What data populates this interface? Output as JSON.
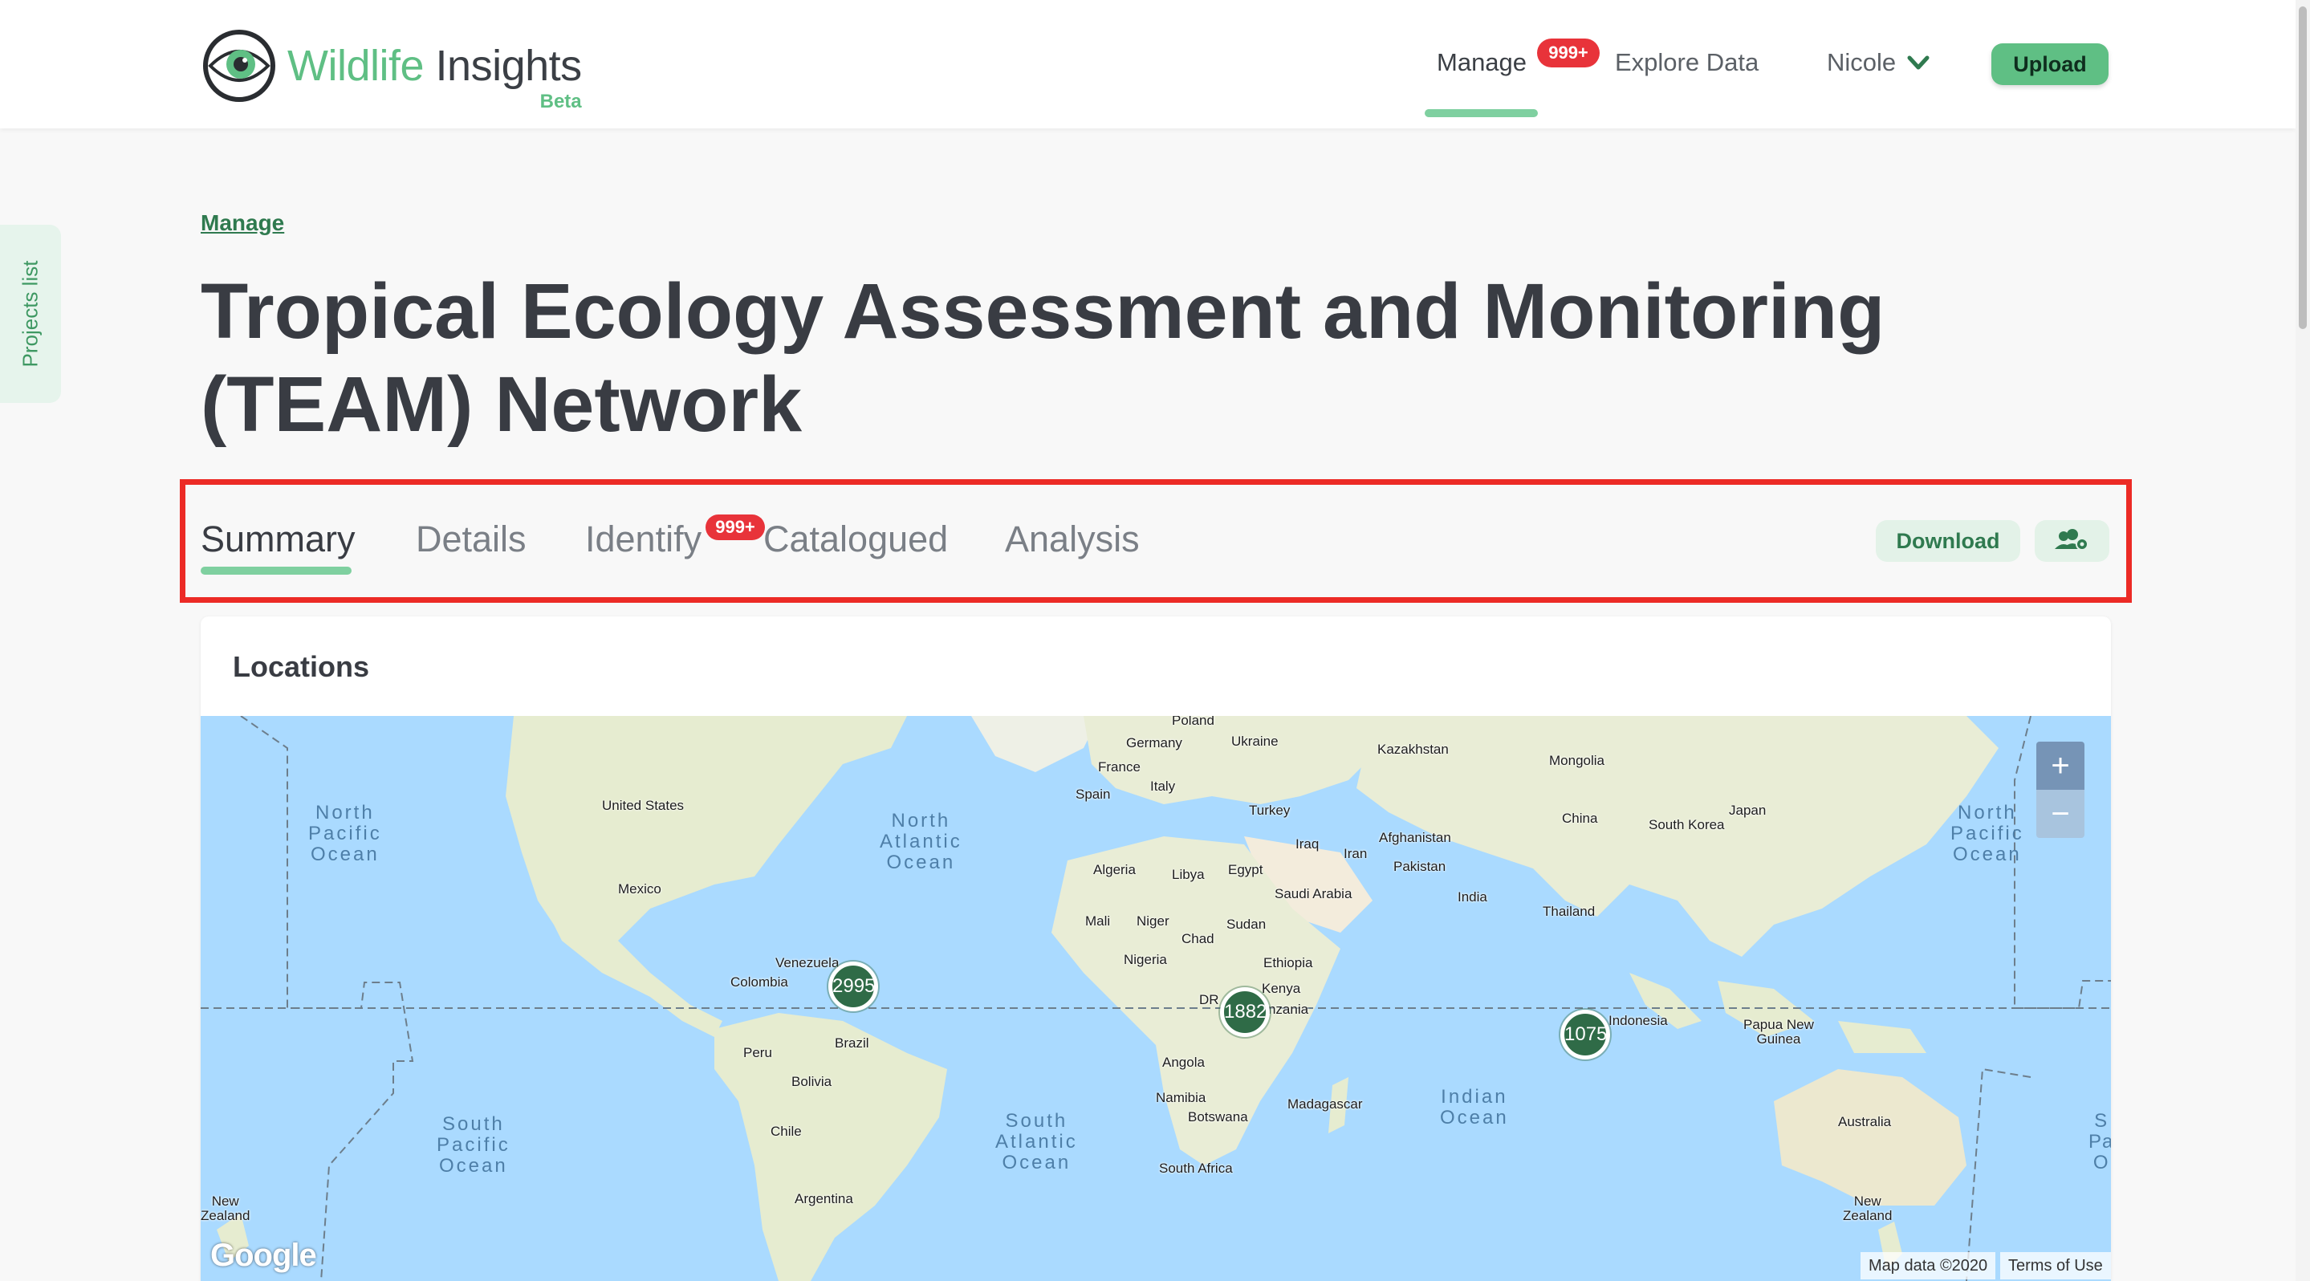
{
  "brand": {
    "name_part1": "Wildlife",
    "name_part2": " Insights",
    "tag": "Beta",
    "color": "#5fbf84"
  },
  "nav": {
    "manage": "Manage",
    "manage_badge": "999+",
    "explore": "Explore Data",
    "user": "Nicole",
    "upload": "Upload"
  },
  "side_tab": {
    "label": "Projects list"
  },
  "breadcrumb": "Manage",
  "title": "Tropical Ecology Assessment and Monitoring (TEAM) Network",
  "tabs": {
    "summary": "Summary",
    "details": "Details",
    "identify": "Identify",
    "identify_badge": "999+",
    "catalogued": "Catalogued",
    "analysis": "Analysis",
    "active": "Summary"
  },
  "actions": {
    "download": "Download",
    "settings_icon": "users-gear-icon"
  },
  "locations": {
    "title": "Locations",
    "zoom_in": "+",
    "zoom_out": "−",
    "clusters": {
      "america": "2995",
      "africa": "1882",
      "asia": "1075"
    },
    "countries": {
      "poland": "Poland",
      "germany": "Germany",
      "ukraine": "Ukraine",
      "france": "France",
      "italy": "Italy",
      "spain": "Spain",
      "turkey": "Turkey",
      "kazakhstan": "Kazakhstan",
      "mongolia": "Mongolia",
      "united_states": "United States",
      "mexico": "Mexico",
      "china": "China",
      "japan": "Japan",
      "south_korea": "South Korea",
      "afghanistan": "Afghanistan",
      "pakistan": "Pakistan",
      "iraq": "Iraq",
      "iran": "Iran",
      "india": "India",
      "algeria": "Algeria",
      "libya": "Libya",
      "egypt": "Egypt",
      "saudi_arabia": "Saudi Arabia",
      "mali": "Mali",
      "niger": "Niger",
      "chad": "Chad",
      "sudan": "Sudan",
      "thailand": "Thailand",
      "nigeria": "Nigeria",
      "ethiopia": "Ethiopia",
      "venezuela": "Venezuela",
      "colombia": "Colombia",
      "dr": "DR",
      "kenya": "Kenya",
      "tanzania": "Tanzania",
      "indonesia": "Indonesia",
      "papua": "Papua New\nGuinea",
      "peru": "Peru",
      "brazil": "Brazil",
      "angola": "Angola",
      "bolivia": "Bolivia",
      "namibia": "Namibia",
      "botswana": "Botswana",
      "madagascar": "Madagascar",
      "chile": "Chile",
      "south_africa": "South Africa",
      "australia": "Australia",
      "argentina": "Argentina",
      "new_zealand_left": "New\nZealand",
      "new_zealand_right": "New\nZealand"
    },
    "oceans": {
      "north_pacific_left": "North\nPacific\nOcean",
      "north_atlantic": "North\nAtlantic\nOcean",
      "north_pacific_right": "North\nPacific\nOcean",
      "south_pacific": "South\nPacific\nOcean",
      "south_atlantic": "South\nAtlantic\nOcean",
      "indian": "Indian\nOcean",
      "south_pacific_edge": "S\nPa\nO"
    },
    "google": "Google",
    "map_data": "Map data ©2020",
    "terms": "Terms of Use",
    "water_color": "#aadaff",
    "land_color": "#e9edd6"
  }
}
